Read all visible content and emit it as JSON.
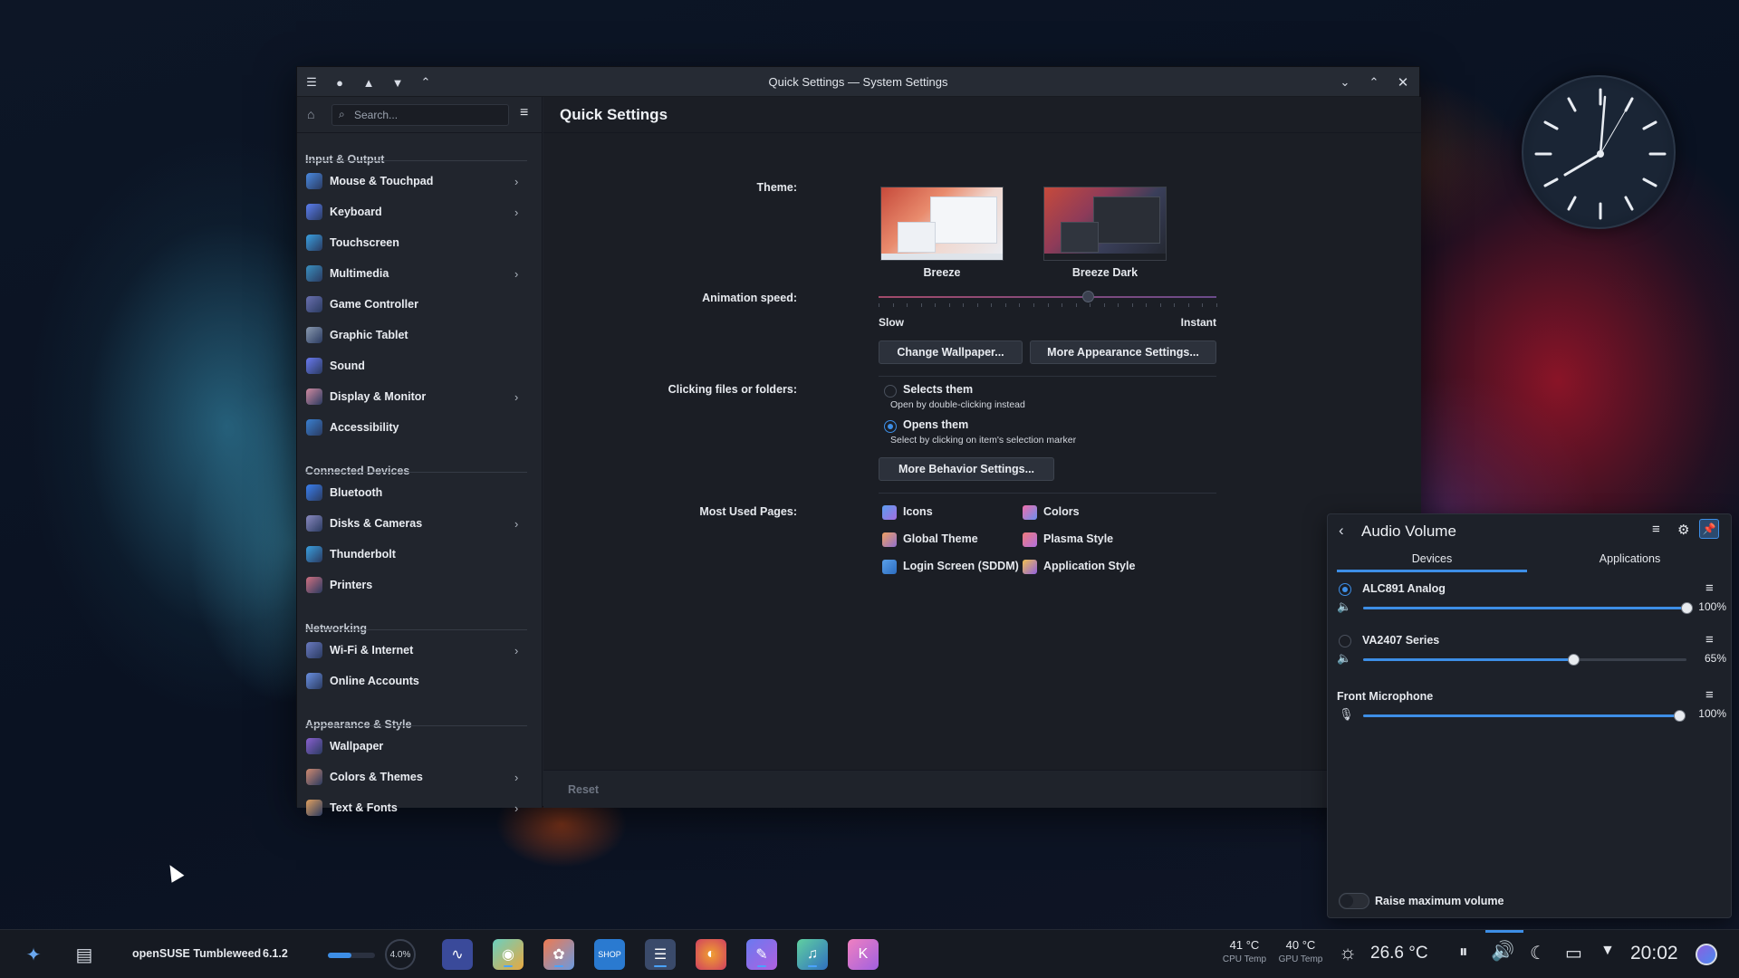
{
  "window": {
    "title": "Quick Settings — System Settings",
    "search_placeholder": "Search...",
    "page_title": "Quick Settings"
  },
  "sidebar": {
    "categories": [
      {
        "label": "Input & Output",
        "items": [
          {
            "label": "Mouse & Touchpad",
            "has_children": true,
            "icon": "mouse-icon"
          },
          {
            "label": "Keyboard",
            "has_children": true,
            "icon": "keyboard-icon"
          },
          {
            "label": "Touchscreen",
            "has_children": false,
            "icon": "touchscreen-icon"
          },
          {
            "label": "Multimedia",
            "has_children": true,
            "icon": "multimedia-icon"
          },
          {
            "label": "Game Controller",
            "has_children": false,
            "icon": "gamepad-icon"
          },
          {
            "label": "Graphic Tablet",
            "has_children": false,
            "icon": "tablet-icon"
          },
          {
            "label": "Sound",
            "has_children": false,
            "icon": "sound-icon"
          },
          {
            "label": "Display & Monitor",
            "has_children": true,
            "icon": "display-icon"
          },
          {
            "label": "Accessibility",
            "has_children": false,
            "icon": "accessibility-icon"
          }
        ]
      },
      {
        "label": "Connected Devices",
        "items": [
          {
            "label": "Bluetooth",
            "has_children": false,
            "icon": "bluetooth-icon"
          },
          {
            "label": "Disks & Cameras",
            "has_children": true,
            "icon": "disk-icon"
          },
          {
            "label": "Thunderbolt",
            "has_children": false,
            "icon": "thunderbolt-icon"
          },
          {
            "label": "Printers",
            "has_children": false,
            "icon": "printer-icon"
          }
        ]
      },
      {
        "label": "Networking",
        "items": [
          {
            "label": "Wi-Fi & Internet",
            "has_children": true,
            "icon": "wifi-icon"
          },
          {
            "label": "Online Accounts",
            "has_children": false,
            "icon": "accounts-icon"
          }
        ]
      },
      {
        "label": "Appearance & Style",
        "items": [
          {
            "label": "Wallpaper",
            "has_children": false,
            "icon": "wallpaper-icon"
          },
          {
            "label": "Colors & Themes",
            "has_children": true,
            "icon": "colors-themes-icon"
          },
          {
            "label": "Text & Fonts",
            "has_children": true,
            "icon": "fonts-icon"
          }
        ]
      }
    ]
  },
  "quick": {
    "theme_label": "Theme:",
    "themes": [
      {
        "name": "Breeze",
        "selected": false
      },
      {
        "name": "Breeze Dark",
        "selected": true
      }
    ],
    "anim_label": "Animation speed:",
    "anim_min": "Slow",
    "anim_max": "Instant",
    "anim_value": 0.62,
    "btn_wallpaper": "Change Wallpaper...",
    "btn_appearance": "More Appearance Settings...",
    "click_label": "Clicking files or folders:",
    "opt1_title": "Selects them",
    "opt1_sub": "Open by double-clicking instead",
    "opt2_title": "Opens them",
    "opt2_sub": "Select by clicking on item's selection marker",
    "btn_behavior": "More Behavior Settings...",
    "most_used_label": "Most Used Pages:",
    "most_used": [
      "Icons",
      "Colors",
      "Global Theme",
      "Plasma Style",
      "Login Screen (SDDM)",
      "Application Style"
    ],
    "reset": "Reset"
  },
  "audio": {
    "title": "Audio Volume",
    "tab_devices": "Devices",
    "tab_apps": "Applications",
    "devices": [
      {
        "name": "ALC891 Analog",
        "volume": 1.0,
        "volume_text": "100%",
        "default": true
      },
      {
        "name": "VA2407 Series",
        "volume": 0.65,
        "volume_text": "65%",
        "default": false
      }
    ],
    "mic": {
      "name": "Front Microphone",
      "volume": 1.0,
      "volume_text": "100%"
    },
    "raise_label": "Raise maximum volume"
  },
  "taskbar": {
    "distro": "openSUSE Tumbleweed",
    "version": "6.1.2",
    "cpu_percent": "4.0%",
    "cpu_temp": "41 °C",
    "cpu_temp_label": "CPU Temp",
    "gpu_temp": "40 °C",
    "gpu_temp_label": "GPU Temp",
    "weather": "26.6 °C",
    "time": "20:02"
  }
}
